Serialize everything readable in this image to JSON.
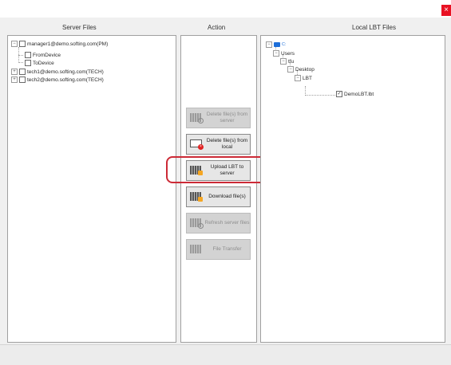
{
  "window": {
    "close_glyph": "×",
    "colors": {
      "highlight": "#cc2a36",
      "close": "#e81123",
      "drive_icon": "#1e6fd9"
    }
  },
  "headers": {
    "server": "Server Files",
    "action": "Action",
    "local": "Local LBT Files"
  },
  "server_tree": [
    {
      "expander": "−",
      "label": "manager1@demo.softing.com(PM)"
    },
    {
      "label": "FromDevice"
    },
    {
      "label": "ToDevice"
    },
    {
      "expander": "+",
      "label": "tech1@demo.softing.com(TECH)"
    },
    {
      "expander": "+",
      "label": "tech2@demo.softing.com(TECH)"
    }
  ],
  "local_tree": [
    {
      "expander": "−",
      "label": "C:",
      "icon": "drive-icon"
    },
    {
      "expander": "−",
      "label": "Users"
    },
    {
      "expander": "−",
      "label": "tfu"
    },
    {
      "expander": "−",
      "label": "Desktop"
    },
    {
      "expander": "−",
      "label": "LBT"
    },
    {
      "label": "DemoLBT.lbt",
      "checked": true,
      "check_glyph": "✓"
    }
  ],
  "actions": [
    {
      "label": "Delete file(s) from server",
      "enabled": false,
      "icon": "server-delete-icon"
    },
    {
      "label": "Delete file(s) from local",
      "enabled": true,
      "icon": "local-delete-icon",
      "badge_glyph": "×"
    },
    {
      "label": "Upload LBT to server",
      "enabled": true,
      "highlighted": true,
      "icon": "upload-icon"
    },
    {
      "label": "Download file(s)",
      "enabled": true,
      "icon": "download-icon"
    },
    {
      "label": "Refresh server files",
      "enabled": false,
      "icon": "refresh-icon"
    },
    {
      "label": "File Transfer",
      "enabled": false,
      "icon": "transfer-icon"
    }
  ]
}
